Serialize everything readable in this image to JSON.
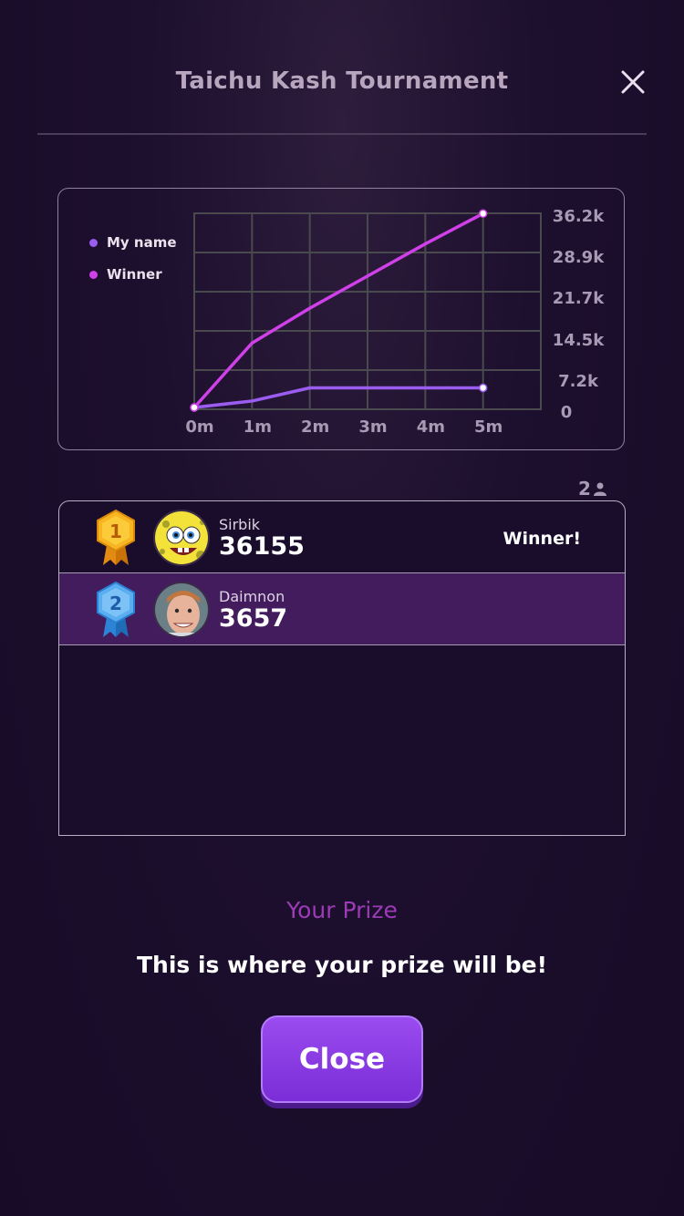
{
  "header": {
    "title": "Taichu Kash Tournament"
  },
  "chart_data": {
    "type": "line",
    "x": [
      "0m",
      "1m",
      "2m",
      "3m",
      "4m",
      "5m"
    ],
    "y_ticks": [
      "36.2k",
      "28.9k",
      "21.7k",
      "14.5k",
      "7.2k",
      "0"
    ],
    "ylim": [
      0,
      36200
    ],
    "legend_position": "top-left",
    "series": [
      {
        "name": "My name",
        "color": "#9b5cf0",
        "values": [
          0,
          1200,
          3657,
          3657,
          3657,
          3657
        ]
      },
      {
        "name": "Winner",
        "color": "#d040e8",
        "values": [
          0,
          12000,
          18500,
          24500,
          30500,
          36155
        ]
      }
    ]
  },
  "players_count": "2",
  "leaderboard": [
    {
      "rank": "1",
      "name": "Sirbik",
      "score": "36155",
      "tag": "Winner!",
      "medal_color": "#f2a81a",
      "avatar": "sponge-avatar"
    },
    {
      "rank": "2",
      "name": "Daimnon",
      "score": "3657",
      "tag": "",
      "medal_color": "#4ea3f2",
      "avatar": "photo-avatar"
    }
  ],
  "prize": {
    "title": "Your Prize",
    "text": "This is where your prize will be!"
  },
  "close_button": {
    "label": "Close"
  }
}
